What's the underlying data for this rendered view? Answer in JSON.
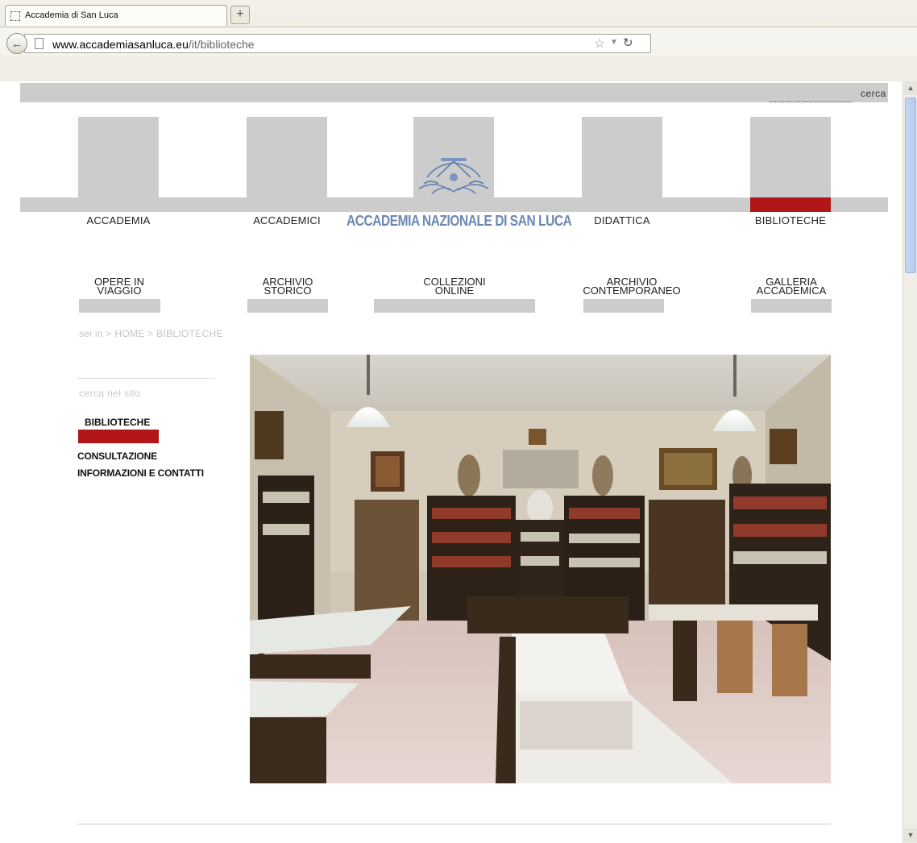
{
  "browser": {
    "tab_title": "Accademia di San Luca",
    "new_tab": "+",
    "url_host": "www.accademiasanluca.eu",
    "url_path": "/it/biblioteche"
  },
  "header": {
    "search_label": "cerca",
    "logo_text": "ACCADEMIA NAZIONALE DI SAN LUCA"
  },
  "main_menu": [
    {
      "label": "ACCADEMIA"
    },
    {
      "label": "ACCADEMICI"
    },
    {
      "label": "DIDATTICA"
    },
    {
      "label": "BIBLIOTECHE",
      "active": true
    }
  ],
  "sub_menu": [
    {
      "label": "OPERE IN\nVIAGGIO"
    },
    {
      "label": "ARCHIVIO\nSTORICO"
    },
    {
      "label": "COLLEZIONI\nONLINE"
    },
    {
      "label": "ARCHIVIO\nCONTEMPORANEO"
    },
    {
      "label": "GALLERIA\nACCADEMICA"
    }
  ],
  "breadcrumb": "sei in > HOME > BIBLIOTECHE",
  "sidebar": {
    "search_label": "cerca nel sito",
    "title": "BIBLIOTECHE",
    "items": [
      {
        "label": "CONSULTAZIONE"
      },
      {
        "label": "INFORMAZIONI E CONTATTI"
      }
    ]
  },
  "colors": {
    "accent_red": "#b01716",
    "grey_block": "#cccccc",
    "logo_blue": "#6a87b4"
  }
}
